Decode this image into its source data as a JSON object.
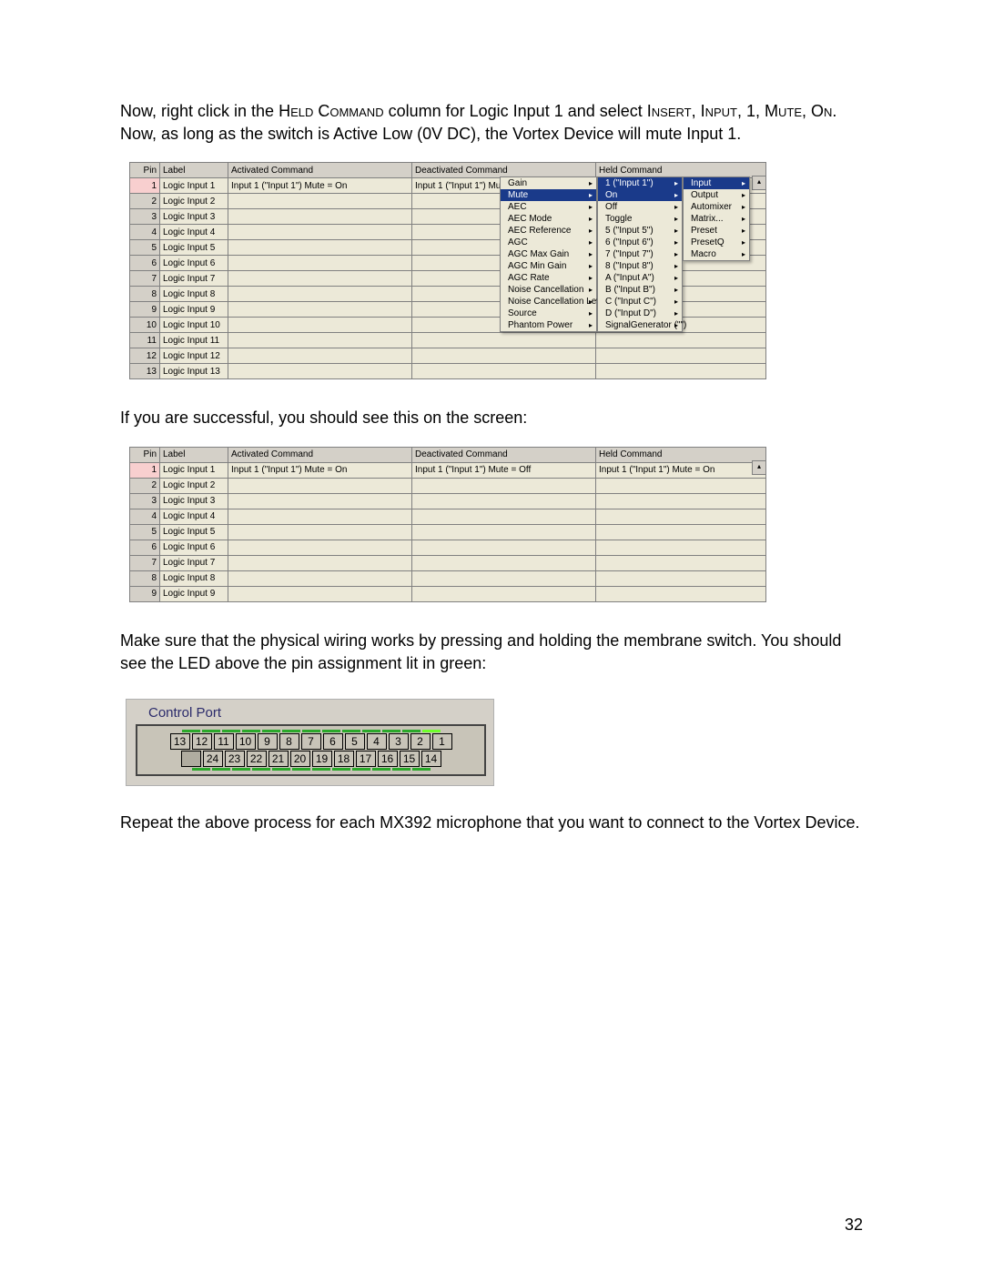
{
  "para1_a": "Now, right click in the ",
  "para1_b": "Held Command",
  "para1_c": " column for Logic Input 1 and select ",
  "para1_d": "Insert",
  "para1_e": ", ",
  "para1_f": "Input",
  "para1_g": ", 1, ",
  "para1_h": "Mute",
  "para1_i": ", ",
  "para1_j": "On",
  "para1_k": ".   Now, as long as the switch is Active Low (0V DC), the Vortex Device will mute Input 1.",
  "para2": "If you are successful, you should see this on the screen:",
  "para3": "Make sure that the physical wiring works by pressing and holding the membrane switch.  You should see the LED above the pin assignment lit in green:",
  "para4": "Repeat the above process for each MX392 microphone that you want to connect to the Vortex Device.",
  "page_num": "32",
  "headers": {
    "pin": "Pin",
    "label": "Label",
    "act": "Activated Command",
    "deact": "Deactivated Command",
    "held": "Held Command"
  },
  "table1_rows": [
    {
      "pin": "1",
      "label": "Logic Input 1",
      "act": "Input 1 (\"Input 1\") Mute = On",
      "deact": "Input 1 (\"Input 1\") Mute = Off",
      "held": ""
    },
    {
      "pin": "2",
      "label": "Logic Input 2",
      "act": "",
      "deact": "",
      "held": ""
    },
    {
      "pin": "3",
      "label": "Logic Input 3",
      "act": "",
      "deact": "",
      "held": ""
    },
    {
      "pin": "4",
      "label": "Logic Input 4",
      "act": "",
      "deact": "",
      "held": ""
    },
    {
      "pin": "5",
      "label": "Logic Input 5",
      "act": "",
      "deact": "",
      "held": ""
    },
    {
      "pin": "6",
      "label": "Logic Input 6",
      "act": "",
      "deact": "",
      "held": ""
    },
    {
      "pin": "7",
      "label": "Logic Input 7",
      "act": "",
      "deact": "",
      "held": ""
    },
    {
      "pin": "8",
      "label": "Logic Input 8",
      "act": "",
      "deact": "",
      "held": ""
    },
    {
      "pin": "9",
      "label": "Logic Input 9",
      "act": "",
      "deact": "",
      "held": ""
    },
    {
      "pin": "10",
      "label": "Logic Input 10",
      "act": "",
      "deact": "",
      "held": ""
    },
    {
      "pin": "11",
      "label": "Logic Input 11",
      "act": "",
      "deact": "",
      "held": ""
    },
    {
      "pin": "12",
      "label": "Logic Input 12",
      "act": "",
      "deact": "",
      "held": ""
    },
    {
      "pin": "13",
      "label": "Logic Input 13",
      "act": "",
      "deact": "",
      "held": ""
    }
  ],
  "menu1": [
    "Gain",
    "Mute",
    "AEC",
    "AEC Mode",
    "AEC Reference",
    "AGC",
    "AGC Max Gain",
    "AGC Min Gain",
    "AGC Rate",
    "Noise Cancellation",
    "Noise Cancellation Level",
    "Source",
    "Phantom Power"
  ],
  "menu1_sel": "Mute",
  "menu2": [
    "1 (\"Input 1\")",
    "On",
    "Off",
    "Toggle",
    "5 (\"Input 5\")",
    "6 (\"Input 6\")",
    "7 (\"Input 7\")",
    "8 (\"Input 8\")",
    "A (\"Input A\")",
    "B (\"Input B\")",
    "C (\"Input C\")",
    "D (\"Input D\")",
    "SignalGenerator (\"\")"
  ],
  "menu2_sel1": "1 (\"Input 1\")",
  "menu2_sel2": "On",
  "menu3": [
    "Input",
    "Output",
    "Automixer",
    "Matrix...",
    "Preset",
    "PresetQ",
    "Macro"
  ],
  "menu3_sel": "Input",
  "table2_rows": [
    {
      "pin": "1",
      "label": "Logic Input 1",
      "act": "Input 1 (\"Input 1\") Mute = On",
      "deact": "Input 1 (\"Input 1\") Mute = Off",
      "held": "Input 1 (\"Input 1\") Mute = On"
    },
    {
      "pin": "2",
      "label": "Logic Input 2",
      "act": "",
      "deact": "",
      "held": ""
    },
    {
      "pin": "3",
      "label": "Logic Input 3",
      "act": "",
      "deact": "",
      "held": ""
    },
    {
      "pin": "4",
      "label": "Logic Input 4",
      "act": "",
      "deact": "",
      "held": ""
    },
    {
      "pin": "5",
      "label": "Logic Input 5",
      "act": "",
      "deact": "",
      "held": ""
    },
    {
      "pin": "6",
      "label": "Logic Input 6",
      "act": "",
      "deact": "",
      "held": ""
    },
    {
      "pin": "7",
      "label": "Logic Input 7",
      "act": "",
      "deact": "",
      "held": ""
    },
    {
      "pin": "8",
      "label": "Logic Input 8",
      "act": "",
      "deact": "",
      "held": ""
    },
    {
      "pin": "9",
      "label": "Logic Input 9",
      "act": "",
      "deact": "",
      "held": ""
    }
  ],
  "cp_title": "Control Port",
  "cp_top": [
    "13",
    "12",
    "11",
    "10",
    "9",
    "8",
    "7",
    "6",
    "5",
    "4",
    "3",
    "2",
    "1"
  ],
  "cp_bot": [
    "",
    "24",
    "23",
    "22",
    "21",
    "20",
    "19",
    "18",
    "17",
    "16",
    "15",
    "14"
  ],
  "cp_lit_index": 12,
  "scroll_glyph": "▴"
}
